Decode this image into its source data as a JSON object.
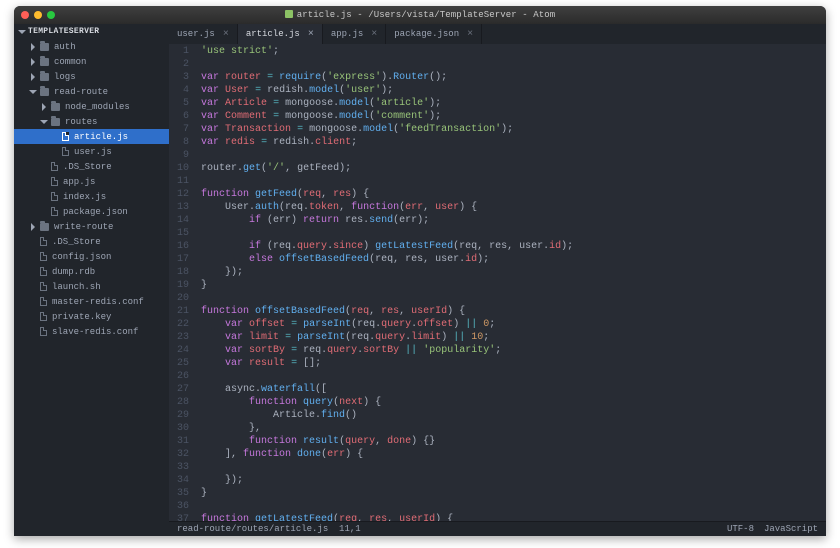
{
  "window": {
    "title": "article.js - /Users/vista/TemplateServer - Atom"
  },
  "project": {
    "name": "TEMPLATESERVER"
  },
  "tree": [
    {
      "d": 1,
      "kind": "folder",
      "open": false,
      "label": "auth"
    },
    {
      "d": 1,
      "kind": "folder",
      "open": false,
      "label": "common"
    },
    {
      "d": 1,
      "kind": "folder",
      "open": false,
      "label": "logs"
    },
    {
      "d": 1,
      "kind": "folder",
      "open": true,
      "label": "read-route"
    },
    {
      "d": 2,
      "kind": "folder",
      "open": false,
      "label": "node_modules"
    },
    {
      "d": 2,
      "kind": "folder",
      "open": true,
      "label": "routes"
    },
    {
      "d": 3,
      "kind": "file",
      "label": "article.js",
      "selected": true
    },
    {
      "d": 3,
      "kind": "file",
      "label": "user.js"
    },
    {
      "d": 2,
      "kind": "file",
      "label": ".DS_Store"
    },
    {
      "d": 2,
      "kind": "file",
      "label": "app.js"
    },
    {
      "d": 2,
      "kind": "file",
      "label": "index.js"
    },
    {
      "d": 2,
      "kind": "file",
      "label": "package.json"
    },
    {
      "d": 1,
      "kind": "folder",
      "open": false,
      "label": "write-route"
    },
    {
      "d": 1,
      "kind": "file",
      "label": ".DS_Store"
    },
    {
      "d": 1,
      "kind": "file",
      "label": "config.json"
    },
    {
      "d": 1,
      "kind": "file",
      "label": "dump.rdb"
    },
    {
      "d": 1,
      "kind": "file",
      "label": "launch.sh"
    },
    {
      "d": 1,
      "kind": "file",
      "label": "master-redis.conf"
    },
    {
      "d": 1,
      "kind": "file",
      "label": "private.key"
    },
    {
      "d": 1,
      "kind": "file",
      "label": "slave-redis.conf"
    }
  ],
  "tabs": [
    {
      "label": "user.js",
      "active": false
    },
    {
      "label": "article.js",
      "active": true
    },
    {
      "label": "app.js",
      "active": false
    },
    {
      "label": "package.json",
      "active": false
    }
  ],
  "lines": [
    "<span class='str'>'use strict'</span>;",
    "",
    "<span class='kw'>var</span> <span class='id'>router</span> <span class='op'>=</span> <span class='fn'>require</span>(<span class='str'>'express'</span>).<span class='fn'>Router</span>();",
    "<span class='kw'>var</span> <span class='id'>User</span> <span class='op'>=</span> redish.<span class='fn'>model</span>(<span class='str'>'user'</span>);",
    "<span class='kw'>var</span> <span class='id'>Article</span> <span class='op'>=</span> mongoose.<span class='fn'>model</span>(<span class='str'>'article'</span>);",
    "<span class='kw'>var</span> <span class='id'>Comment</span> <span class='op'>=</span> mongoose.<span class='fn'>model</span>(<span class='str'>'comment'</span>);",
    "<span class='kw'>var</span> <span class='id'>Transaction</span> <span class='op'>=</span> mongoose.<span class='fn'>model</span>(<span class='str'>'feedTransaction'</span>);",
    "<span class='kw'>var</span> <span class='id'>redis</span> <span class='op'>=</span> redish.<span class='prop'>client</span>;",
    "",
    "router.<span class='fn'>get</span>(<span class='str'>'/'</span>, getFeed);",
    "",
    "<span class='kw'>function</span> <span class='fn'>getFeed</span>(<span class='id'>req</span>, <span class='id'>res</span>) {",
    "    User.<span class='fn'>auth</span>(req.<span class='prop'>token</span>, <span class='kw'>function</span>(<span class='id'>err</span>, <span class='id'>user</span>) {",
    "        <span class='kw'>if</span> (err) <span class='kw'>return</span> res.<span class='fn'>send</span>(err);",
    "",
    "        <span class='kw'>if</span> (req.<span class='prop'>query</span>.<span class='prop'>since</span>) <span class='fn'>getLatestFeed</span>(req, res, user.<span class='prop'>id</span>);",
    "        <span class='kw'>else</span> <span class='fn'>offsetBasedFeed</span>(req, res, user.<span class='prop'>id</span>);",
    "    });",
    "}",
    "",
    "<span class='kw'>function</span> <span class='fn'>offsetBasedFeed</span>(<span class='id'>req</span>, <span class='id'>res</span>, <span class='id'>userId</span>) {",
    "    <span class='kw'>var</span> <span class='id'>offset</span> <span class='op'>=</span> <span class='fn'>parseInt</span>(req.<span class='prop'>query</span>.<span class='prop'>offset</span>) <span class='op'>||</span> <span class='num'>0</span>;",
    "    <span class='kw'>var</span> <span class='id'>limit</span> <span class='op'>=</span> <span class='fn'>parseInt</span>(req.<span class='prop'>query</span>.<span class='prop'>limit</span>) <span class='op'>||</span> <span class='num'>10</span>;",
    "    <span class='kw'>var</span> <span class='id'>sortBy</span> <span class='op'>=</span> req.<span class='prop'>query</span>.<span class='prop'>sortBy</span> <span class='op'>||</span> <span class='str'>'popularity'</span>;",
    "    <span class='kw'>var</span> <span class='id'>result</span> <span class='op'>=</span> [];",
    "",
    "    async.<span class='fn'>waterfall</span>([",
    "        <span class='kw'>function</span> <span class='fn'>query</span>(<span class='id'>next</span>) {",
    "            Article.<span class='fn'>find</span>()",
    "        },",
    "        <span class='kw'>function</span> <span class='fn'>result</span>(<span class='id'>query</span>, <span class='id'>done</span>) {}",
    "    ], <span class='kw'>function</span> <span class='fn'>done</span>(<span class='id'>err</span>) {",
    "",
    "    });",
    "}",
    "",
    "<span class='kw'>function</span> <span class='fn'>getLatestFeed</span>(<span class='id'>req</span>, <span class='id'>res</span>, <span class='id'>userId</span>) {"
  ],
  "status": {
    "path": "read-route/routes/article.js",
    "pos": "11,1",
    "encoding": "UTF-8",
    "language": "JavaScript"
  },
  "glyphs": {
    "close": "×"
  }
}
